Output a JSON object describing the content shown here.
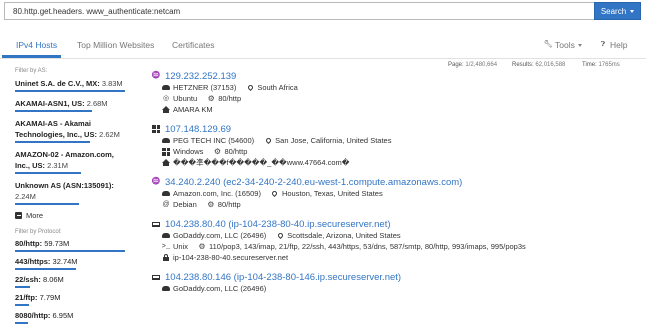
{
  "search": {
    "query": "80.http.get.headers. www_authenticate:netcam",
    "button_label": "Search"
  },
  "tabs": [
    {
      "label": "IPv4 Hosts",
      "active": true
    },
    {
      "label": "Top Million Websites",
      "active": false
    },
    {
      "label": "Certificates",
      "active": false
    }
  ],
  "toolbar": {
    "tools_label": "Tools",
    "help_label": "Help"
  },
  "stats": {
    "page_label": "Page:",
    "page_value": "1/2,480,664",
    "results_label": "Results:",
    "results_value": "62,016,588",
    "time_label": "Time:",
    "time_value": "1765ms"
  },
  "sidebar": {
    "as_heading": "Filter by AS:",
    "as_items": [
      {
        "label": "Uninet S.A. de C.V., MX:",
        "count": "3.83M",
        "fraction": 1.0
      },
      {
        "label": "AKAMAI-ASN1, US:",
        "count": "2.68M",
        "fraction": 0.7
      },
      {
        "label": "AKAMAI-AS - Akamai Technologies, Inc., US:",
        "count": "2.62M",
        "fraction": 0.68
      },
      {
        "label": "AMAZON-02 - Amazon.com, Inc., US:",
        "count": "2.31M",
        "fraction": 0.6
      },
      {
        "label": "Unknown AS (ASN:135091):",
        "count": "2.24M",
        "fraction": 0.58
      }
    ],
    "more_label": "More",
    "protocol_heading": "Filter by Protocol:",
    "protocol_items": [
      {
        "label": "80/http:",
        "count": "59.73M",
        "fraction": 1.0
      },
      {
        "label": "443/https:",
        "count": "32.74M",
        "fraction": 0.55
      },
      {
        "label": "22/ssh:",
        "count": "8.06M",
        "fraction": 0.14
      },
      {
        "label": "21/ftp:",
        "count": "7.79M",
        "fraction": 0.13
      },
      {
        "label": "8080/http:",
        "count": "6.95M",
        "fraction": 0.12
      }
    ]
  },
  "results": [
    {
      "os_icon": "linux-icon",
      "title": "129.232.252.139",
      "lines": [
        [
          {
            "icon": "cloud-icon",
            "text": "HETZNER (37153)"
          },
          {
            "icon": "location-pin-icon",
            "text": "South Africa"
          }
        ],
        [
          {
            "icon": "ubuntu-icon",
            "text": "Ubuntu"
          },
          {
            "icon": "gear-icon",
            "text": "80/http"
          }
        ],
        [
          {
            "icon": "home-icon",
            "text": "AMARA KM"
          }
        ]
      ]
    },
    {
      "os_icon": "windows-icon",
      "title": "107.148.129.69",
      "lines": [
        [
          {
            "icon": "cloud-icon",
            "text": "PEG TECH INC (54600)"
          },
          {
            "icon": "location-pin-icon",
            "text": "San Jose, California, United States"
          }
        ],
        [
          {
            "icon": "windows-icon",
            "text": "Windows"
          },
          {
            "icon": "gear-icon",
            "text": "80/http"
          }
        ],
        [
          {
            "icon": "home-icon",
            "text": "���凖���f�����_��www.47664.com�"
          }
        ]
      ]
    },
    {
      "os_icon": "linux-icon",
      "title": "34.240.2.240 (ec2-34-240-2-240.eu-west-1.compute.amazonaws.com)",
      "lines": [
        [
          {
            "icon": "cloud-icon",
            "text": "Amazon.com, Inc. (16509)"
          },
          {
            "icon": "location-pin-icon",
            "text": "Houston, Texas, United States"
          }
        ],
        [
          {
            "icon": "debian-icon",
            "text": "Debian"
          },
          {
            "icon": "gear-icon",
            "text": "80/http"
          }
        ]
      ]
    },
    {
      "os_icon": "laptop-icon",
      "title": "104.238.80.40 (ip-104-238-80-40.ip.secureserver.net)",
      "lines": [
        [
          {
            "icon": "cloud-icon",
            "text": "GoDaddy.com, LLC (26496)"
          },
          {
            "icon": "location-pin-icon",
            "text": "Scottsdale, Arizona, United States"
          }
        ],
        [
          {
            "icon": "terminal-icon",
            "text": "Unix"
          },
          {
            "icon": "gear-icon",
            "text": "110/pop3, 143/imap, 21/ftp, 22/ssh, 443/https, 53/dns, 587/smtp, 80/http, 993/imaps, 995/pop3s"
          }
        ],
        [
          {
            "icon": "lock-icon",
            "text": "ip-104-238-80-40.secureserver.net"
          }
        ]
      ]
    },
    {
      "os_icon": "laptop-icon",
      "title": "104.238.80.146 (ip-104-238-80-146.ip.secureserver.net)",
      "lines": [
        [
          {
            "icon": "cloud-icon",
            "text": "GoDaddy.com, LLC (26496)"
          }
        ]
      ]
    }
  ],
  "colors": {
    "accent": "#3275c4",
    "text": "#333333",
    "muted": "#777777"
  }
}
